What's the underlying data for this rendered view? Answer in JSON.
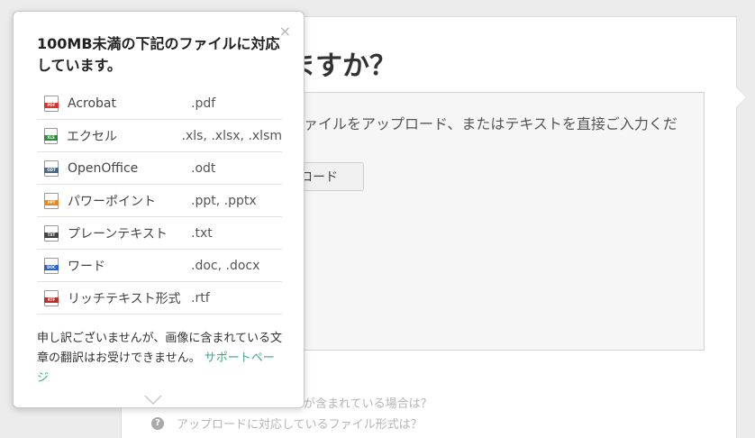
{
  "background": {
    "heading": "ますか？",
    "upload_text": "ァイルをアップロード、またはテキストを直接ご入力くだ",
    "upload_button": "ロード",
    "faq_link_1": "が含まれている場合は？",
    "faq_link_2": "アップロードに対応しているファイル形式は？",
    "help_icon_glyph": "?"
  },
  "popover": {
    "close_glyph": "×",
    "title": "100MB未満の下記のファイルに対応しています。",
    "files": [
      {
        "name": "Acrobat",
        "ext": ".pdf",
        "icon": "pdf-file-icon",
        "badge": "PDF",
        "color": "#d9342b"
      },
      {
        "name": "エクセル",
        "ext": ".xls, .xlsx, .xlsm",
        "icon": "xls-file-icon",
        "badge": "XLS",
        "color": "#2e8b3a"
      },
      {
        "name": "OpenOffice",
        "ext": ".odt",
        "icon": "odt-file-icon",
        "badge": "ODT",
        "color": "#4a6785"
      },
      {
        "name": "パワーポイント",
        "ext": ".ppt, .pptx",
        "icon": "ppt-file-icon",
        "badge": "PPT",
        "color": "#e8861f"
      },
      {
        "name": "プレーンテキスト",
        "ext": ".txt",
        "icon": "txt-file-icon",
        "badge": "TXT",
        "color": "#444444"
      },
      {
        "name": "ワード",
        "ext": ".doc, .docx",
        "icon": "doc-file-icon",
        "badge": "DOC",
        "color": "#2b63c4"
      },
      {
        "name": "リッチテキスト形式",
        "ext": ".rtf",
        "icon": "rtf-file-icon",
        "badge": "RTF",
        "color": "#b5312b"
      }
    ],
    "note": "申し訳ございませんが、画像に含まれている文章の翻訳はお受けできません。",
    "support_link": "サポートページ"
  }
}
